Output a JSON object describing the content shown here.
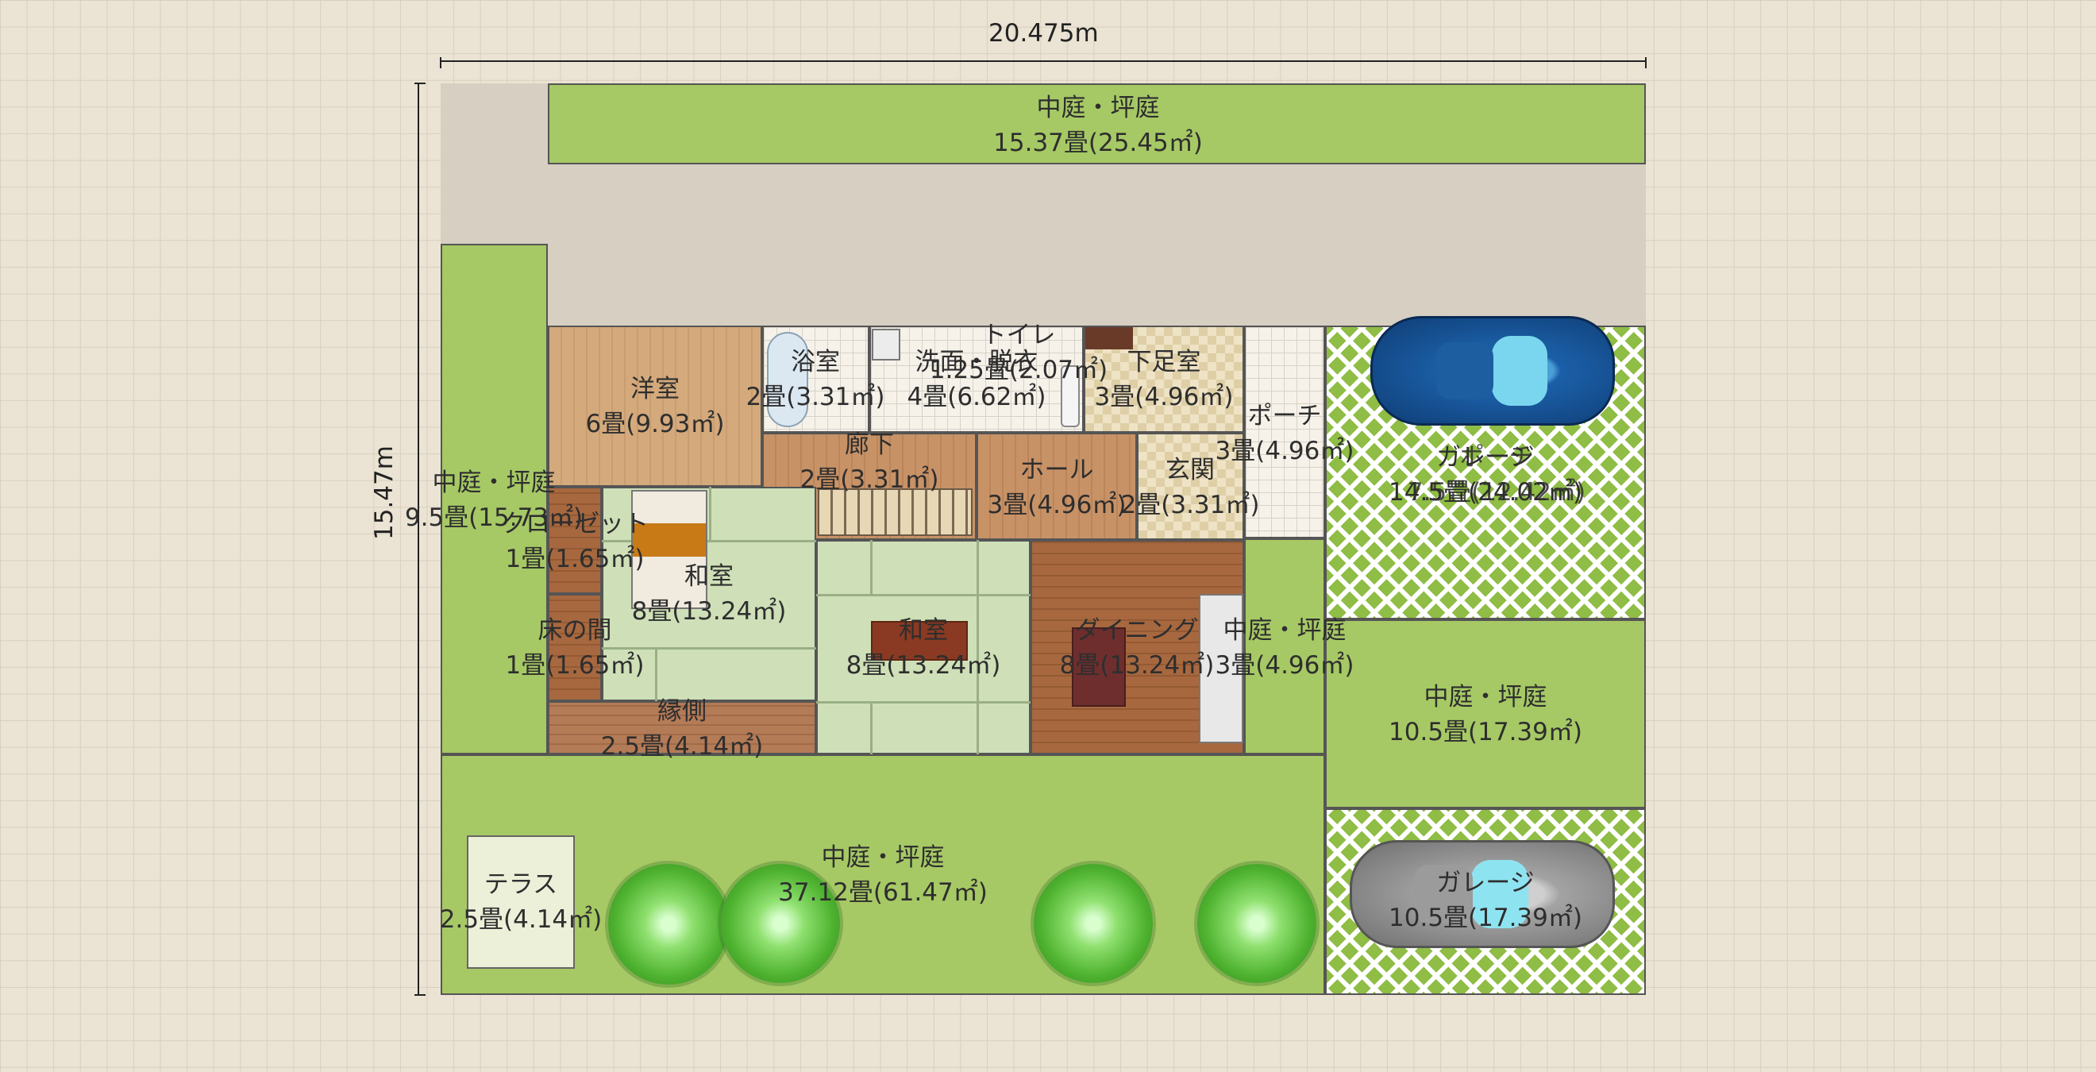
{
  "dimensions": {
    "width_label": "20.475m",
    "height_label": "15.47m"
  },
  "rooms": {
    "garden_top": {
      "name": "中庭・坪庭",
      "area": "15.37畳(25.45㎡)"
    },
    "garden_left": {
      "name": "中庭・坪庭",
      "area": "9.5畳(15.73㎡)"
    },
    "western": {
      "name": "洋室",
      "area": "6畳(9.93㎡)"
    },
    "bath": {
      "name": "浴室",
      "area": "2畳(3.31㎡)"
    },
    "washroom": {
      "name": "洗面・脱衣",
      "area": "4畳(6.62㎡)"
    },
    "toilet": {
      "name": "トイレ",
      "area": "1.25畳(2.07㎡)"
    },
    "shoe_room": {
      "name": "下足室",
      "area": "3畳(4.96㎡)"
    },
    "porch": {
      "name": "ポーチ",
      "area": "3畳(4.96㎡)"
    },
    "corridor": {
      "name": "廊下",
      "area": "2畳(3.31㎡)"
    },
    "hall": {
      "name": "ホール",
      "area": "3畳(4.96㎡)"
    },
    "entrance": {
      "name": "玄関",
      "area": "2畳(3.31㎡)"
    },
    "closet": {
      "name": "クローゼット",
      "area": "1畳(1.65㎡)"
    },
    "washitsu1": {
      "name": "和室",
      "area": "8畳(13.24㎡)"
    },
    "washitsu2": {
      "name": "和室",
      "area": "8畳(13.24㎡)"
    },
    "tokonoma": {
      "name": "床の間",
      "area": "1畳(1.65㎡)"
    },
    "engawa": {
      "name": "縁側",
      "area": "2.5畳(4.14㎡)"
    },
    "dining": {
      "name": "ダイニング",
      "area": "8畳(13.24㎡)"
    },
    "garden_mid": {
      "name": "中庭・坪庭",
      "area": "3畳(4.96㎡)"
    },
    "garage_top": {
      "name": "ガレージ",
      "area": "14.5畳(24.02㎡)"
    },
    "porch_overlap": {
      "name": "ポーチ",
      "area": "7.5畳(12.42㎡)"
    },
    "garden_right": {
      "name": "中庭・坪庭",
      "area": "10.5畳(17.39㎡)"
    },
    "garage_bottom": {
      "name": "ガレージ",
      "area": "10.5畳(17.39㎡)"
    },
    "garden_bottom": {
      "name": "中庭・坪庭",
      "area": "37.12畳(61.47㎡)"
    },
    "terrace": {
      "name": "テラス",
      "area": "2.5畳(4.14㎡)"
    }
  },
  "colors": {
    "garden": "#a6c965",
    "car_top": "#1b5fa8",
    "car_bottom": "#a3a3a3",
    "wall": "#555555"
  }
}
